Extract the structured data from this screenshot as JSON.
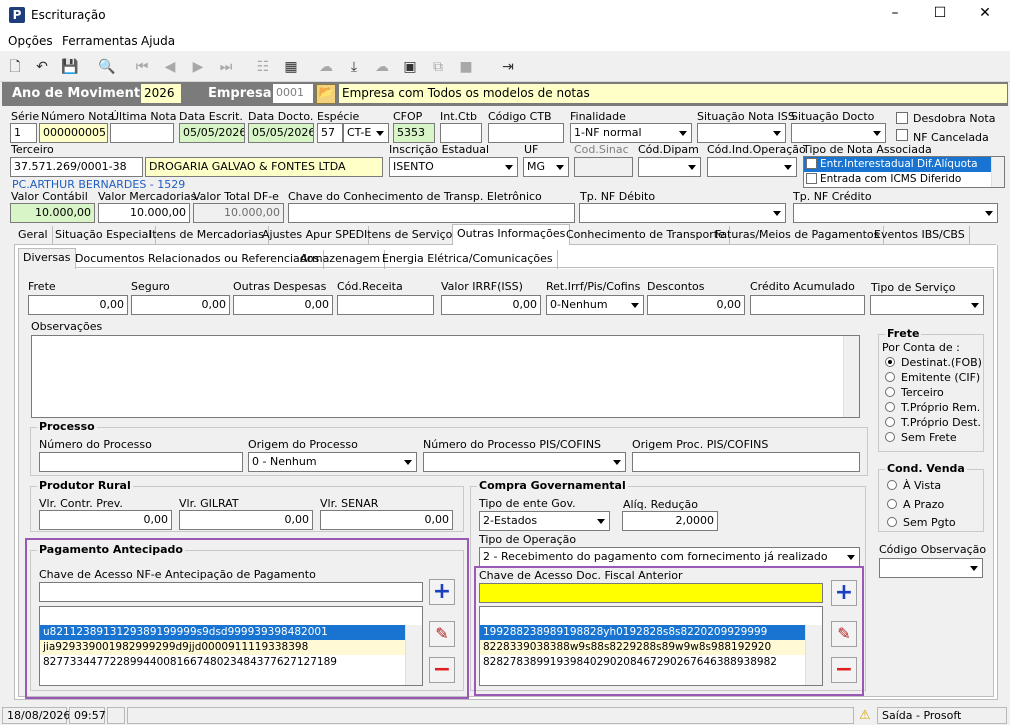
{
  "window": {
    "title": "Escrituração",
    "minimize": "–",
    "maximize": "☐",
    "close": "✕",
    "app_icon": "P"
  },
  "menu": [
    "Opções",
    "Ferramentas",
    "Ajuda"
  ],
  "header": {
    "ano_label": "Ano de Movimento",
    "ano_value": "2026",
    "empresa_label": "Empresa",
    "empresa_code": "0001",
    "empresa_name": "Empresa com Todos os modelos de notas"
  },
  "row1": {
    "serie_label": "Série",
    "serie": "1",
    "numero_label": "Número Nota",
    "numero": "000000005",
    "ultima_label": "Última Nota",
    "ultima": "",
    "data_escrit_label": "Data Escrit.",
    "data_escrit": "05/05/2026",
    "data_docto_label": "Data Docto.",
    "data_docto": "05/05/2026",
    "especie_label": "Espécie",
    "especie_code": "57",
    "especie": "CT-E",
    "cfop_label": "CFOP",
    "cfop": "5353",
    "intctb_label": "Int.Ctb",
    "codctb_label": "Código CTB",
    "finalidade_label": "Finalidade",
    "finalidade": "1-NF normal",
    "sit_iss_label": "Situação Nota ISS",
    "sit_docto_label": "Situação Docto",
    "desdobra_label": "Desdobra Nota",
    "cancelada_label": "NF Cancelada"
  },
  "row2": {
    "terceiro_label": "Terceiro",
    "cnpj": "37.571.269/0001-38",
    "razao": "DROGARIA GALVAO & FONTES LTDA",
    "endereco": "PC.ARTHUR BERNARDES - 1529",
    "ie_label": "Inscrição Estadual",
    "ie": "ISENTO",
    "uf_label": "UF",
    "uf": "MG",
    "sinac_label": "Cod.Sinac",
    "dipam_label": "Cód.Dipam",
    "indop_label": "Cód.Ind.Operação",
    "tipo_assoc_label": "Tipo de Nota Associada",
    "assoc_items": [
      "Entr.Interestadual Dif.Alíquota",
      "Entrada com ICMS Diferido"
    ]
  },
  "row3": {
    "vcontabil_label": "Valor Contábil",
    "vcontabil": "10.000,00",
    "vmerc_label": "Valor Mercadorias",
    "vmerc": "10.000,00",
    "vdfe_label": "Valor Total DF-e",
    "vdfe": "10.000,00",
    "chave_label": "Chave do Conhecimento de Transp. Eletrônico",
    "tpdeb_label": "Tp. NF Débito",
    "tpcred_label": "Tp. NF Crédito"
  },
  "tabs": [
    "Geral",
    "Situação Especial",
    "Itens de Mercadorias",
    "Ajustes Apur SPED",
    "Itens de Serviços",
    "Outras Informações",
    "Conhecimento de Transporte",
    "Faturas/Meios de Pagamentos",
    "Eventos IBS/CBS"
  ],
  "subtabs": [
    "Diversas",
    "Documentos Relacionados ou Referenciados",
    "Armazenagem",
    "Energia Elétrica/Comunicações"
  ],
  "fields": {
    "frete_label": "Frete",
    "frete": "0,00",
    "seguro_label": "Seguro",
    "seguro": "0,00",
    "outras_label": "Outras Despesas",
    "outras": "0,00",
    "codrec_label": "Cód.Receita",
    "irrf_label": "Valor IRRF(ISS)",
    "irrf": "0,00",
    "ret_label": "Ret.Irrf/Pis/Cofins",
    "ret": "0-Nenhum",
    "desc_label": "Descontos",
    "desc": "0,00",
    "cred_label": "Crédito Acumulado",
    "tiposerv_label": "Tipo de Serviço",
    "obs_label": "Observações"
  },
  "processo": {
    "title": "Processo",
    "num_label": "Número do Processo",
    "origem_label": "Origem do Processo",
    "origem": "0 - Nenhum",
    "numpis_label": "Número do Processo PIS/COFINS",
    "origpis_label": "Origem Proc. PIS/COFINS"
  },
  "produtor": {
    "title": "Produtor Rural",
    "contr_label": "Vlr. Contr. Prev.",
    "contr": "0,00",
    "gilrat_label": "Vlr. GILRAT",
    "gilrat": "0,00",
    "senar_label": "Vlr. SENAR",
    "senar": "0,00"
  },
  "compra": {
    "title": "Compra Governamental",
    "ente_label": "Tipo de ente Gov.",
    "ente": "2-Estados",
    "aliq_label": "Alíq. Redução",
    "aliq": "2,0000",
    "oper_label": "Tipo de Operação",
    "oper": "2 - Recebimento do pagamento com fornecimento já realizado",
    "chave_label": "Chave de Acesso Doc. Fiscal Anterior",
    "chaves": [
      "199288238989198828yh0192828s8s8220209929999",
      "8228339038388w9s88s8229288s89w9w8s988192920",
      "82827838991939840290208467290267646388938982"
    ]
  },
  "pagamento": {
    "title": "Pagamento Antecipado",
    "chave_label": "Chave de Acesso NF-e Antecipação de Pagamento",
    "chaves": [
      "u8211238913129389199999s9dsd999939398482001",
      "jia929339001982999299d9jjd0000911119338398",
      "82773344772289944008166748023484377627127189"
    ]
  },
  "frete_box": {
    "title": "Frete",
    "por_conta": "Por Conta de :",
    "opcoes": [
      "Destinat.(FOB)",
      "Emitente (CIF)",
      "Terceiro",
      "T.Próprio Rem.",
      "T.Próprio Dest.",
      "Sem Frete"
    ]
  },
  "venda_box": {
    "title": "Cond. Venda",
    "opcoes": [
      "À Vista",
      "A Prazo",
      "Sem Pgto"
    ]
  },
  "codobs_label": "Código Observação",
  "status": {
    "date": "18/08/2026",
    "time": "09:57",
    "exit": "Saída - Prosoft"
  },
  "colors": {
    "accent": "#1874d0",
    "frame": "#9b59b6",
    "highlight": "#ffff00"
  }
}
